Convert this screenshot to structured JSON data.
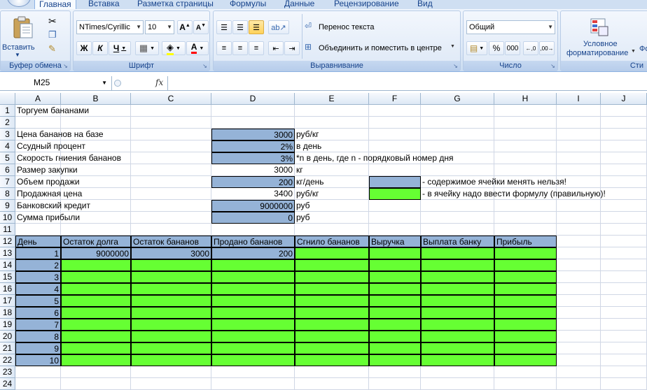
{
  "ribbon": {
    "tabs": [
      "Главная",
      "Вставка",
      "Разметка страницы",
      "Формулы",
      "Данные",
      "Рецензирование",
      "Вид"
    ],
    "clipboard": {
      "paste_label": "Вставить",
      "group_label": "Буфер обмена"
    },
    "font": {
      "name": "NTimes/Cyrillic",
      "size": "10",
      "bold": "Ж",
      "italic": "К",
      "underline": "Ч",
      "group_label": "Шрифт"
    },
    "alignment": {
      "wrap_label": "Перенос текста",
      "merge_label": "Объединить и поместить в центре",
      "group_label": "Выравнивание"
    },
    "number": {
      "format": "Общий",
      "percent": "%",
      "thousands": "000",
      "group_label": "Число"
    },
    "styles": {
      "conditional_label_1": "Условное",
      "conditional_label_2": "форматирование",
      "format_label": "Фо",
      "group_label": "Сти"
    }
  },
  "formula_bar": {
    "name_box": "M25",
    "fx": "fx",
    "formula": ""
  },
  "columns": [
    "A",
    "B",
    "C",
    "D",
    "E",
    "F",
    "G",
    "H",
    "I",
    "J"
  ],
  "rows": [
    "1",
    "2",
    "3",
    "4",
    "5",
    "6",
    "7",
    "8",
    "9",
    "10",
    "11",
    "12",
    "13",
    "14",
    "15",
    "16",
    "17",
    "18",
    "19",
    "20",
    "21",
    "22",
    "23",
    "24"
  ],
  "sheet": {
    "title": "Торгуем бананами",
    "params": [
      {
        "label": "Цена бананов на базе",
        "value": "3000",
        "unit": "руб/кг"
      },
      {
        "label": "Ссудный процент",
        "value": "2%",
        "unit": "в день"
      },
      {
        "label": "Скорость гниения бананов",
        "value": "3%",
        "unit": "*n в день, где n - порядковый номер дня"
      },
      {
        "label": "Размер закупки",
        "value": "3000",
        "unit": "кг"
      },
      {
        "label": "Объем продажи",
        "value": "200",
        "unit": "кг/день"
      },
      {
        "label": "Продажная цена",
        "value": "3400",
        "unit": "руб/кг"
      },
      {
        "label": "Банковский кредит",
        "value": "9000000",
        "unit": "руб"
      },
      {
        "label": "Сумма прибыли",
        "value": "0",
        "unit": "руб"
      }
    ],
    "legend": {
      "blue_text": "- содержимое ячейки менять нельзя!",
      "green_text": "- в ячейку надо ввести формулу (правильную)!"
    },
    "table_headers": [
      "День",
      "Остаток долга",
      "Остаток бананов",
      "Продано бананов",
      "Сгнило бананов",
      "Выручка",
      "Выплата банку",
      "Прибыль"
    ],
    "table_row1": [
      "1",
      "9000000",
      "3000",
      "200"
    ],
    "days": [
      "2",
      "3",
      "4",
      "5",
      "6",
      "7",
      "8",
      "9",
      "10"
    ]
  },
  "colors": {
    "locked_blue": "#95b3d7",
    "formula_green": "#66ff33"
  }
}
